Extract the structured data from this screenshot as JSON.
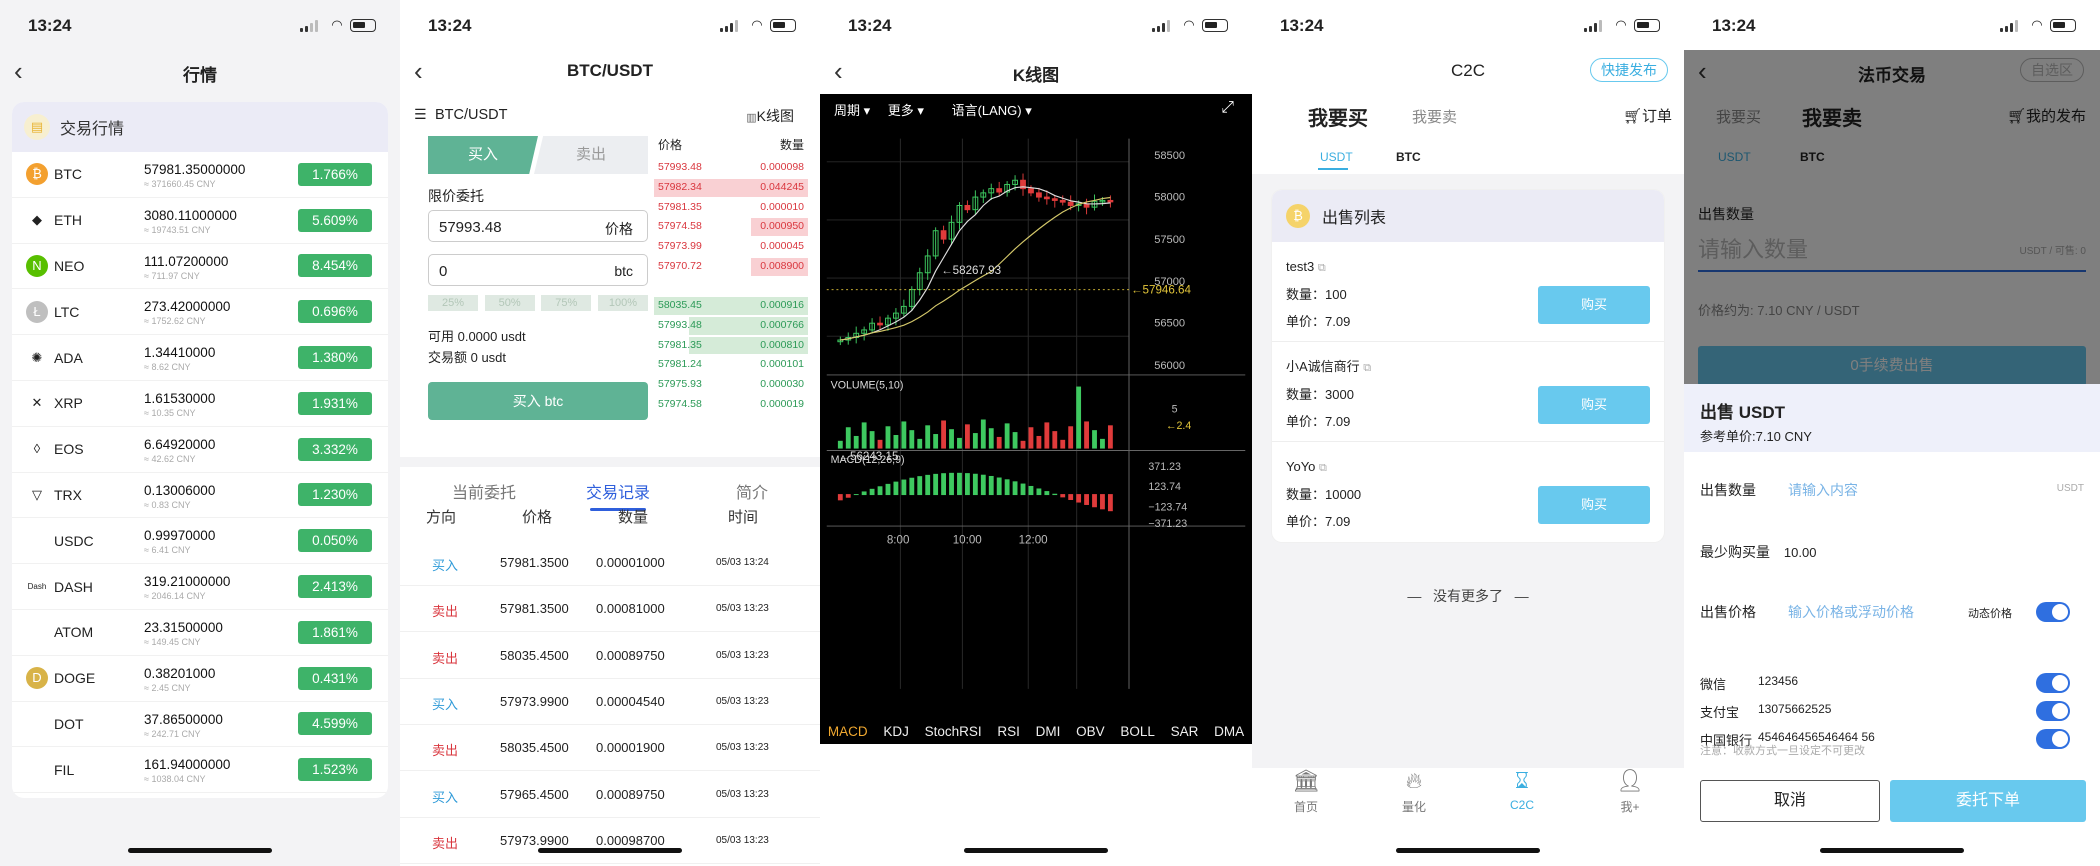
{
  "status_time": "13:24",
  "market": {
    "title": "行情",
    "header": "交易行情",
    "rows": [
      {
        "name": "BTC",
        "price": "57981.35000000",
        "cny": "≈ 371660.45 CNY",
        "pct": "1.766%",
        "icon_color": "#f3a02f",
        "glyph": "₿"
      },
      {
        "name": "ETH",
        "price": "3080.11000000",
        "cny": "≈ 19743.51 CNY",
        "pct": "5.609%",
        "icon_color": "#ffffff",
        "glyph": "◆"
      },
      {
        "name": "NEO",
        "price": "111.07200000",
        "cny": "≈ 711.97 CNY",
        "pct": "8.454%",
        "icon_color": "#58bf00",
        "glyph": "N"
      },
      {
        "name": "LTC",
        "price": "273.42000000",
        "cny": "≈ 1752.62 CNY",
        "pct": "0.696%",
        "icon_color": "#bfbfbf",
        "glyph": "Ł"
      },
      {
        "name": "ADA",
        "price": "1.34410000",
        "cny": "≈ 8.62 CNY",
        "pct": "1.380%",
        "icon_color": "#ffffff",
        "glyph": "✺"
      },
      {
        "name": "XRP",
        "price": "1.61530000",
        "cny": "≈ 10.35 CNY",
        "pct": "1.931%",
        "icon_color": "#ffffff",
        "glyph": "✕"
      },
      {
        "name": "EOS",
        "price": "6.64920000",
        "cny": "≈ 42.62 CNY",
        "pct": "3.332%",
        "icon_color": "#ffffff",
        "glyph": "◊"
      },
      {
        "name": "TRX",
        "price": "0.13006000",
        "cny": "≈ 0.83 CNY",
        "pct": "1.230%",
        "icon_color": "#ffffff",
        "glyph": "▽"
      },
      {
        "name": "USDC",
        "price": "0.99970000",
        "cny": "≈ 6.41 CNY",
        "pct": "0.050%",
        "icon_color": "#ffffff",
        "glyph": ""
      },
      {
        "name": "DASH",
        "price": "319.21000000",
        "cny": "≈ 2046.14 CNY",
        "pct": "2.413%",
        "icon_color": "#ffffff",
        "glyph": "Dash"
      },
      {
        "name": "ATOM",
        "price": "23.31500000",
        "cny": "≈ 149.45 CNY",
        "pct": "1.861%",
        "icon_color": "#ffffff",
        "glyph": ""
      },
      {
        "name": "DOGE",
        "price": "0.38201000",
        "cny": "≈ 2.45 CNY",
        "pct": "0.431%",
        "icon_color": "#d8b348",
        "glyph": "D"
      },
      {
        "name": "DOT",
        "price": "37.86500000",
        "cny": "≈ 242.71 CNY",
        "pct": "4.599%",
        "icon_color": "#ffffff",
        "glyph": ""
      },
      {
        "name": "FIL",
        "price": "161.94000000",
        "cny": "≈ 1038.04 CNY",
        "pct": "1.523%",
        "icon_color": "#ffffff",
        "glyph": ""
      }
    ]
  },
  "trade": {
    "title": "BTC/USDT",
    "pair": "BTC/USDT",
    "kline_link": "K线图",
    "tab_buy": "买入",
    "tab_sell": "卖出",
    "limit_label": "限价委托",
    "price_value": "57993.48",
    "price_unit": "价格",
    "amount_value": "0",
    "amount_unit": "btc",
    "pcts": [
      "25%",
      "50%",
      "75%",
      "100%"
    ],
    "available": "可用 0.0000 usdt",
    "volume": "交易额 0 usdt",
    "buy_button": "买入 btc",
    "ob_head_price": "价格",
    "ob_head_qty": "数量",
    "asks": [
      {
        "p": "57993.48",
        "q": "0.000098",
        "depth": 0
      },
      {
        "p": "57982.34",
        "q": "0.044245",
        "depth": 1
      },
      {
        "p": "57981.35",
        "q": "0.000010",
        "depth": 0
      },
      {
        "p": "57974.58",
        "q": "0.000950",
        "depth": 0.37
      },
      {
        "p": "57973.99",
        "q": "0.000045",
        "depth": 0
      },
      {
        "p": "57970.72",
        "q": "0.008900",
        "depth": 0.37
      }
    ],
    "bids": [
      {
        "p": "58035.45",
        "q": "0.000916",
        "depth": 1
      },
      {
        "p": "57993.48",
        "q": "0.000766",
        "depth": 0.77
      },
      {
        "p": "57981.35",
        "q": "0.000810",
        "depth": 0.77
      },
      {
        "p": "57981.24",
        "q": "0.000101",
        "depth": 0
      },
      {
        "p": "57975.93",
        "q": "0.000030",
        "depth": 0
      },
      {
        "p": "57974.58",
        "q": "0.000019",
        "depth": 0
      }
    ],
    "tabs": [
      "当前委托",
      "交易记录",
      "简介"
    ],
    "table_head": [
      "方向",
      "价格",
      "数量",
      "时间"
    ],
    "records": [
      {
        "dir": "买入",
        "price": "57981.3500",
        "qty": "0.00001000",
        "time": "05/03 13:24",
        "side": "buy"
      },
      {
        "dir": "卖出",
        "price": "57981.3500",
        "qty": "0.00081000",
        "time": "05/03 13:23",
        "side": "sell"
      },
      {
        "dir": "卖出",
        "price": "58035.4500",
        "qty": "0.00089750",
        "time": "05/03 13:23",
        "side": "sell"
      },
      {
        "dir": "买入",
        "price": "57973.9900",
        "qty": "0.00004540",
        "time": "05/03 13:23",
        "side": "buy"
      },
      {
        "dir": "卖出",
        "price": "58035.4500",
        "qty": "0.00001900",
        "time": "05/03 13:23",
        "side": "sell"
      },
      {
        "dir": "买入",
        "price": "57965.4500",
        "qty": "0.00089750",
        "time": "05/03 13:23",
        "side": "buy"
      },
      {
        "dir": "卖出",
        "price": "57973.9900",
        "qty": "0.00098700",
        "time": "05/03 13:23",
        "side": "sell"
      }
    ]
  },
  "kline": {
    "title": "K线图",
    "menu": [
      "周期",
      "更多",
      "语言(LANG)"
    ],
    "price_ticks": [
      "58500",
      "58000",
      "57500",
      "57000",
      "56500",
      "56000"
    ],
    "current_price": "57946.64",
    "high_label": "58267.93",
    "low_label": "56243.15",
    "volume_label": "VOLUME(5,10)",
    "volume_ticks": [
      "5",
      "2.4"
    ],
    "macd_label": "MACD(12,26,9)",
    "macd_ticks": [
      "371.23",
      "123.74",
      "−123.74",
      "−371.23"
    ],
    "time_ticks": [
      "8:00",
      "10:00",
      "12:00"
    ],
    "indicators": [
      "MACD",
      "KDJ",
      "StochRSI",
      "RSI",
      "DMI",
      "OBV",
      "BOLL",
      "SAR",
      "DMA"
    ]
  },
  "c2c": {
    "title": "C2C",
    "publish": "快捷发布",
    "buy_tab": "我要买",
    "sell_tab": "我要卖",
    "orders": "订单",
    "coin_tabs": [
      "USDT",
      "BTC"
    ],
    "list_title": "出售列表",
    "sellers": [
      {
        "name": "test3",
        "qty_label": "数量：",
        "qty": "100",
        "price_label": "单价：",
        "price": "7.09",
        "btn": "购买"
      },
      {
        "name": "小A诚信商行",
        "qty_label": "数量：",
        "qty": "3000",
        "price_label": "单价：",
        "price": "7.09",
        "btn": "购买"
      },
      {
        "name": "YoYo",
        "qty_label": "数量：",
        "qty": "10000",
        "price_label": "单价：",
        "price": "7.09",
        "btn": "购买"
      }
    ],
    "no_more": "没有更多了",
    "tabbar": [
      "首页",
      "量化",
      "C2C",
      "我+"
    ]
  },
  "otc": {
    "title": "法币交易",
    "self_area": "自选区",
    "buy_tab": "我要买",
    "sell_tab": "我要卖",
    "my_publish": "我的发布",
    "coin_tabs": [
      "USDT",
      "BTC"
    ],
    "qty_label": "出售数量",
    "qty_placeholder": "请输入数量",
    "qty_unit": "USDT / 可售: 0",
    "approx": "价格约为: 7.10 CNY / USDT",
    "fee_btn": "0手续费出售",
    "sheet_title": "出售 USDT",
    "ref_price": "参考单价:7.10 CNY",
    "sell_qty_label": "出售数量",
    "sell_qty_placeholder": "请输入内容",
    "sell_qty_unit": "USDT",
    "min_label": "最少购买量",
    "min_value": "10.00",
    "price_label": "出售价格",
    "price_placeholder": "输入价格或浮动价格",
    "dyn_price": "动态价格",
    "payments": [
      {
        "name": "微信",
        "value": "123456"
      },
      {
        "name": "支付宝",
        "value": "13075662525"
      },
      {
        "name": "中国银行",
        "value": "454646456546464 56"
      }
    ],
    "note": "注意：收款方式一旦设定不可更改",
    "cancel": "取消",
    "submit": "委托下单"
  }
}
